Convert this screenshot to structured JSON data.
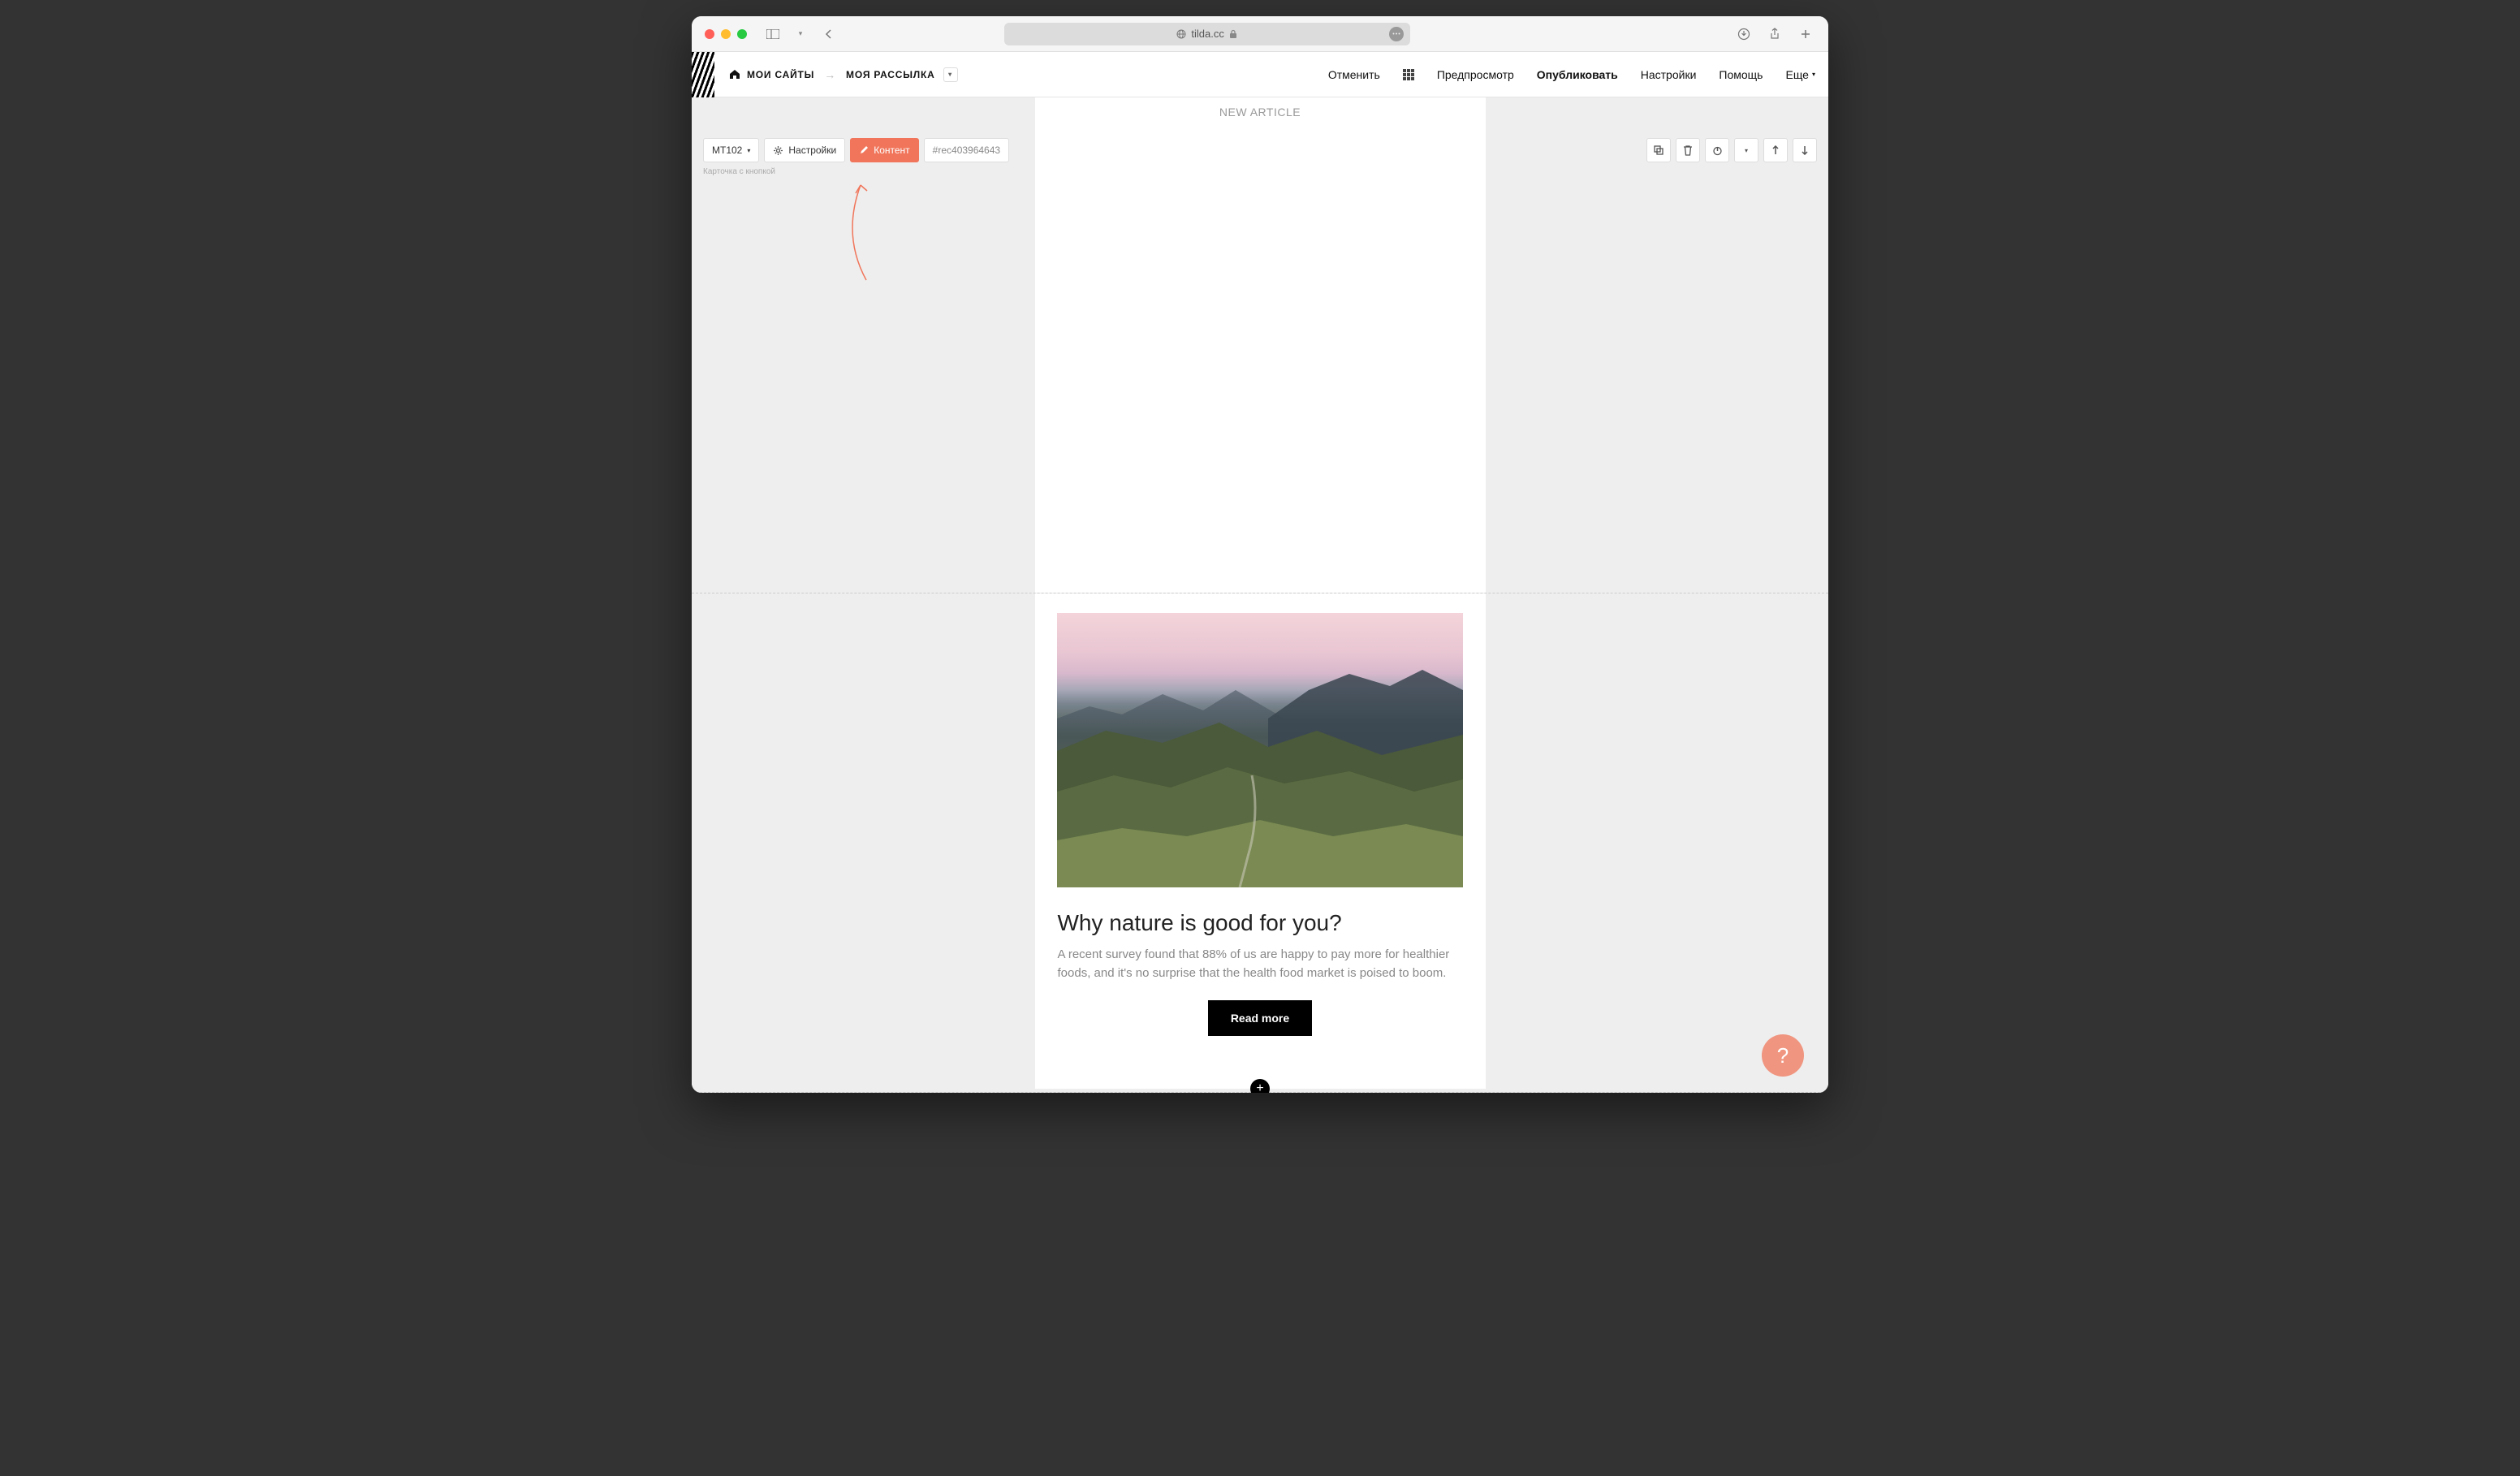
{
  "browser": {
    "url": "tilda.cc"
  },
  "breadcrumb": {
    "home": "МОИ САЙТЫ",
    "current": "МОЯ РАССЫЛКА"
  },
  "topbar": {
    "cancel": "Отменить",
    "preview": "Предпросмотр",
    "publish": "Опубликовать",
    "settings": "Настройки",
    "help": "Помощь",
    "more": "Еще"
  },
  "editor": {
    "section_label": "NEW ARTICLE",
    "block_toolbar": {
      "block_type": "MT102",
      "settings": "Настройки",
      "content": "Контент",
      "rec_id": "#rec403964643"
    },
    "block_caption": "Карточка с кнопкой"
  },
  "card": {
    "title": "Why nature is good for you?",
    "description": "A recent survey found that 88% of us are happy to pay more for healthier foods, and it's no surprise that the health food market is poised to boom.",
    "button_label": "Read more"
  },
  "help_bubble": "?"
}
